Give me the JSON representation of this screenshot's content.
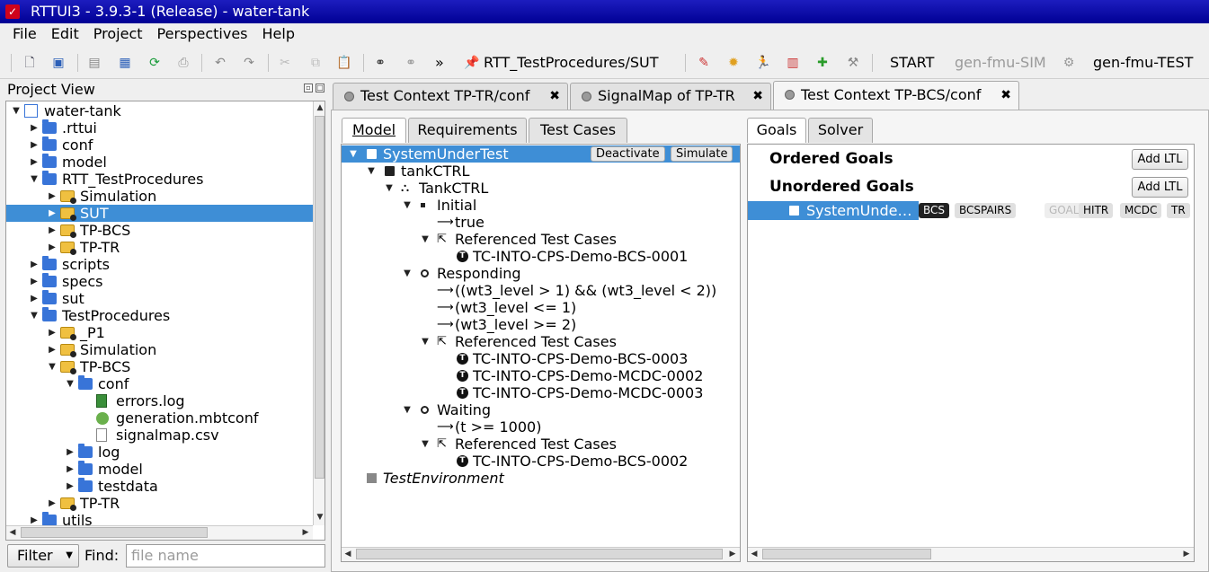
{
  "window": {
    "title": "RTTUI3 - 3.9.3-1 (Release) - water-tank"
  },
  "menu": [
    "File",
    "Edit",
    "Project",
    "Perspectives",
    "Help"
  ],
  "toolbar": {
    "path": "RTT_TestProcedures/SUT",
    "start": "START",
    "gen_sim": "gen-fmu-SIM",
    "gen_test": "gen-fmu-TEST",
    "more": "»"
  },
  "project_view": {
    "title": "Project View",
    "tree": [
      {
        "label": "water-tank",
        "depth": 0,
        "icon": "project-icon",
        "expanded": true
      },
      {
        "label": ".rttui",
        "depth": 1,
        "icon": "folder-icon",
        "expanded": false
      },
      {
        "label": "conf",
        "depth": 1,
        "icon": "folder-icon",
        "expanded": false
      },
      {
        "label": "model",
        "depth": 1,
        "icon": "model-folder-icon",
        "expanded": false
      },
      {
        "label": "RTT_TestProcedures",
        "depth": 1,
        "icon": "folder-icon",
        "expanded": true
      },
      {
        "label": "Simulation",
        "depth": 2,
        "icon": "package-icon",
        "expanded": false
      },
      {
        "label": "SUT",
        "depth": 2,
        "icon": "package-icon",
        "expanded": false,
        "selected": true
      },
      {
        "label": "TP-BCS",
        "depth": 2,
        "icon": "package-icon",
        "expanded": false
      },
      {
        "label": "TP-TR",
        "depth": 2,
        "icon": "package-icon",
        "expanded": false
      },
      {
        "label": "scripts",
        "depth": 1,
        "icon": "folder-icon",
        "expanded": false
      },
      {
        "label": "specs",
        "depth": 1,
        "icon": "folder-icon",
        "expanded": false
      },
      {
        "label": "sut",
        "depth": 1,
        "icon": "folder-icon",
        "expanded": false
      },
      {
        "label": "TestProcedures",
        "depth": 1,
        "icon": "folder-icon",
        "expanded": true
      },
      {
        "label": "_P1",
        "depth": 2,
        "icon": "package-icon",
        "expanded": false
      },
      {
        "label": "Simulation",
        "depth": 2,
        "icon": "package-icon",
        "expanded": false
      },
      {
        "label": "TP-BCS",
        "depth": 2,
        "icon": "package-icon",
        "expanded": true
      },
      {
        "label": "conf",
        "depth": 3,
        "icon": "folder-icon",
        "expanded": true
      },
      {
        "label": "errors.log",
        "depth": 4,
        "icon": "log-file-icon"
      },
      {
        "label": "generation.mbtconf",
        "depth": 4,
        "icon": "config-file-icon"
      },
      {
        "label": "signalmap.csv",
        "depth": 4,
        "icon": "file-icon"
      },
      {
        "label": "log",
        "depth": 3,
        "icon": "folder-icon",
        "expanded": false
      },
      {
        "label": "model",
        "depth": 3,
        "icon": "folder-icon",
        "expanded": false
      },
      {
        "label": "testdata",
        "depth": 3,
        "icon": "folder-icon",
        "expanded": false
      },
      {
        "label": "TP-TR",
        "depth": 2,
        "icon": "package-icon",
        "expanded": false
      },
      {
        "label": "utils",
        "depth": 1,
        "icon": "folder-icon",
        "expanded": false
      }
    ],
    "filter_label": "Filter",
    "find_label": "Find:",
    "find_placeholder": "file name"
  },
  "editor_tabs": [
    {
      "label": "Test Context TP-TR/conf",
      "active": false
    },
    {
      "label": "SignalMap of TP-TR",
      "active": false
    },
    {
      "label": "Test Context TP-BCS/conf",
      "active": true
    }
  ],
  "left_tabs": [
    "Model",
    "Requirements",
    "Test Cases"
  ],
  "right_tabs": [
    "Goals",
    "Solver"
  ],
  "model_tree": {
    "deactivate": "Deactivate",
    "simulate": "Simulate",
    "rows": [
      {
        "label": "SystemUnderTest",
        "depth": 0,
        "icon": "component-icon",
        "expanded": true,
        "selected": true
      },
      {
        "label": "tankCTRL",
        "depth": 1,
        "icon": "component-icon",
        "expanded": true
      },
      {
        "label": "TankCTRL",
        "depth": 2,
        "icon": "statechart-icon",
        "expanded": true
      },
      {
        "label": "Initial",
        "depth": 3,
        "icon": "initial-state-icon",
        "expanded": true
      },
      {
        "label": "true",
        "depth": 4,
        "icon": "transition-arrow-icon"
      },
      {
        "label": "Referenced Test Cases",
        "depth": 4,
        "icon": "reference-icon",
        "expanded": true
      },
      {
        "label": "TC-INTO-CPS-Demo-BCS-0001",
        "depth": 5,
        "icon": "test-case-icon"
      },
      {
        "label": "Responding",
        "depth": 3,
        "icon": "state-icon",
        "expanded": true
      },
      {
        "label": "((wt3_level > 1) && (wt3_level < 2))",
        "depth": 4,
        "icon": "transition-arrow-icon"
      },
      {
        "label": "(wt3_level <= 1)",
        "depth": 4,
        "icon": "transition-arrow-icon"
      },
      {
        "label": "(wt3_level >= 2)",
        "depth": 4,
        "icon": "transition-arrow-icon"
      },
      {
        "label": "Referenced Test Cases",
        "depth": 4,
        "icon": "reference-icon",
        "expanded": true
      },
      {
        "label": "TC-INTO-CPS-Demo-BCS-0003",
        "depth": 5,
        "icon": "test-case-icon"
      },
      {
        "label": "TC-INTO-CPS-Demo-MCDC-0002",
        "depth": 5,
        "icon": "test-case-icon"
      },
      {
        "label": "TC-INTO-CPS-Demo-MCDC-0003",
        "depth": 5,
        "icon": "test-case-icon"
      },
      {
        "label": "Waiting",
        "depth": 3,
        "icon": "state-icon",
        "expanded": true
      },
      {
        "label": "(t >= 1000)",
        "depth": 4,
        "icon": "transition-arrow-icon"
      },
      {
        "label": "Referenced Test Cases",
        "depth": 4,
        "icon": "reference-icon",
        "expanded": true
      },
      {
        "label": "TC-INTO-CPS-Demo-BCS-0002",
        "depth": 5,
        "icon": "test-case-icon"
      },
      {
        "label": "TestEnvironment",
        "depth": 0,
        "icon": "inactive-component-icon",
        "italic": true
      }
    ]
  },
  "goals": {
    "ordered_title": "Ordered Goals",
    "unordered_title": "Unordered Goals",
    "add_ltl": "Add LTL",
    "row_label": "SystemUnde…",
    "badges": [
      {
        "label": "BCS",
        "style": "dark"
      },
      {
        "label": "BCSPAIRS",
        "style": "normal"
      },
      {
        "label": "GOAL",
        "style": "faint"
      },
      {
        "label": "HITR",
        "style": "normal"
      },
      {
        "label": "MCDC",
        "style": "normal"
      },
      {
        "label": "TR",
        "style": "normal"
      }
    ]
  }
}
